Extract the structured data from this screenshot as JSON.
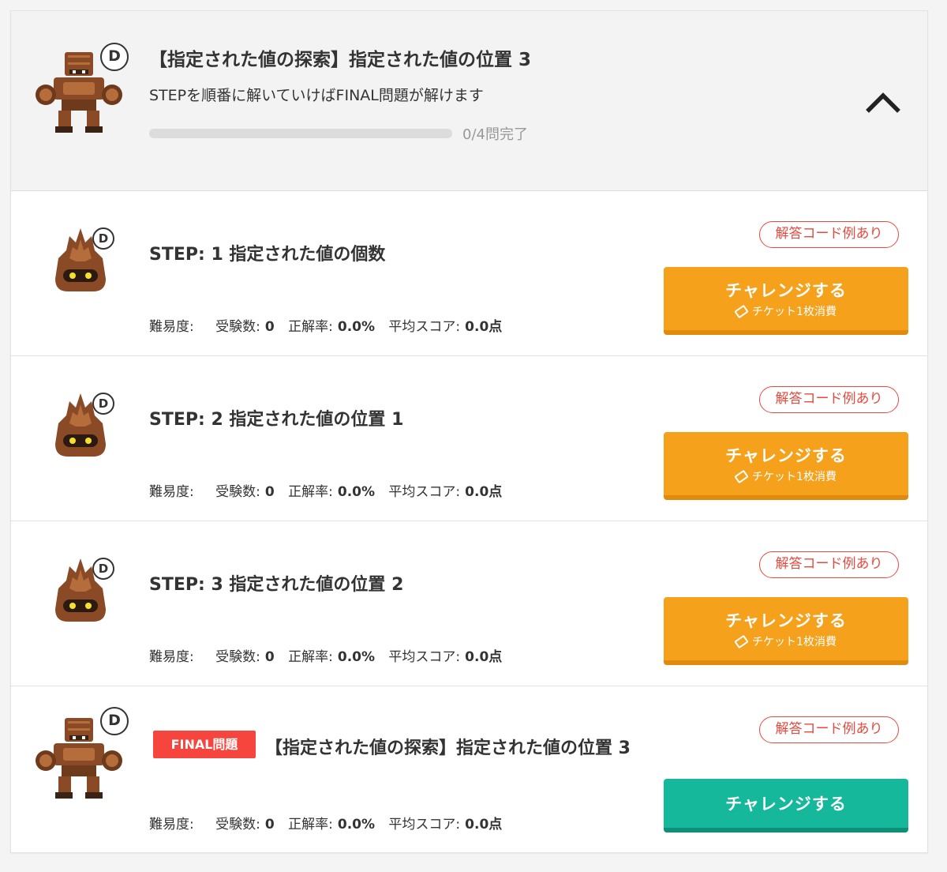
{
  "header": {
    "rank": "D",
    "title": "【指定された値の探索】指定された値の位置 3",
    "subtitle": "STEPを順番に解いていけばFINAL問題が解けます",
    "progress": {
      "completed": 0,
      "total": 4,
      "label": "0/4問完了"
    },
    "toggle_icon": "chevron-up-icon"
  },
  "labels": {
    "difficulty": "難易度:",
    "examinees": "受験数:",
    "accuracy": "正解率:",
    "avg_score": "平均スコア:",
    "answer_code": "解答コード例あり",
    "challenge": "チャレンジする",
    "ticket": "チケット1枚消費",
    "final_tag": "FINAL問題"
  },
  "steps": [
    {
      "rank": "D",
      "title": "STEP: 1 指定された値の個数",
      "examinees": "0",
      "accuracy": "0.0%",
      "avg_score": "0.0点"
    },
    {
      "rank": "D",
      "title": "STEP: 2 指定された値の位置 1",
      "examinees": "0",
      "accuracy": "0.0%",
      "avg_score": "0.0点"
    },
    {
      "rank": "D",
      "title": "STEP: 3 指定された値の位置 2",
      "examinees": "0",
      "accuracy": "0.0%",
      "avg_score": "0.0点"
    }
  ],
  "final": {
    "rank": "D",
    "title": "【指定された値の探索】指定された値の位置 3",
    "examinees": "0",
    "accuracy": "0.0%",
    "avg_score": "0.0点"
  },
  "colors": {
    "orange": "#f5a11c",
    "teal": "#16b89b",
    "red": "#f5453c",
    "badge": "#e64a3f"
  }
}
